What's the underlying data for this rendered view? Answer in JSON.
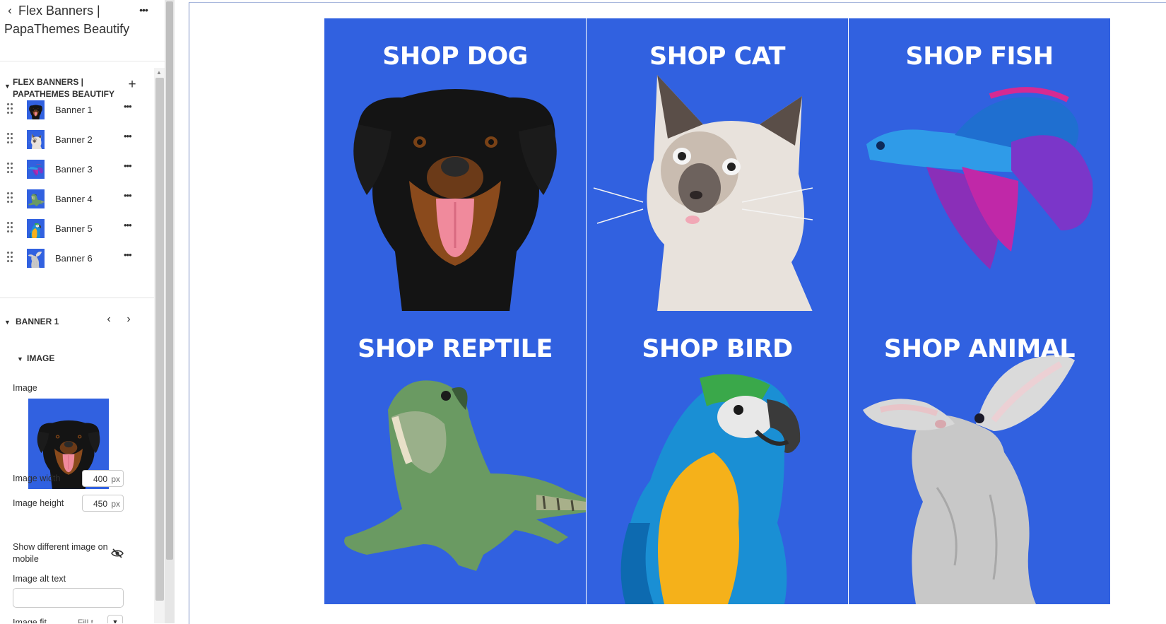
{
  "header": {
    "back_icon": "chevron-left-icon",
    "title": "Flex Banners | PapaThemes Beautify",
    "more_icon": "more-horizontal-icon"
  },
  "section": {
    "title": "FLEX BANNERS | PAPATHEMES BEAUTIFY",
    "add_icon": "plus-icon"
  },
  "blocks": [
    {
      "label": "Banner 1",
      "thumb": "dog"
    },
    {
      "label": "Banner 2",
      "thumb": "cat"
    },
    {
      "label": "Banner 3",
      "thumb": "fish"
    },
    {
      "label": "Banner 4",
      "thumb": "reptile"
    },
    {
      "label": "Banner 5",
      "thumb": "bird"
    },
    {
      "label": "Banner 6",
      "thumb": "rabbit"
    }
  ],
  "banner_settings": {
    "title": "BANNER 1",
    "image_group_title": "IMAGE",
    "image_label": "Image",
    "width_label": "Image width",
    "width_value": "400",
    "width_unit": "px",
    "height_label": "Image height",
    "height_value": "450",
    "height_unit": "px",
    "mobile_label": "Show different image on mobile",
    "alt_label": "Image alt text",
    "alt_value": "",
    "fit_label": "Image fit",
    "fit_value": "Fill t"
  },
  "banners": [
    {
      "title": "SHOP DOG"
    },
    {
      "title": "SHOP CAT"
    },
    {
      "title": "SHOP FISH"
    },
    {
      "title": "SHOP REPTILE"
    },
    {
      "title": "SHOP BIRD"
    },
    {
      "title": "SHOP ANIMAL"
    }
  ],
  "colors": {
    "banner_bg": "#3161e0",
    "banner_text": "#ffffff",
    "text": "#303030"
  }
}
